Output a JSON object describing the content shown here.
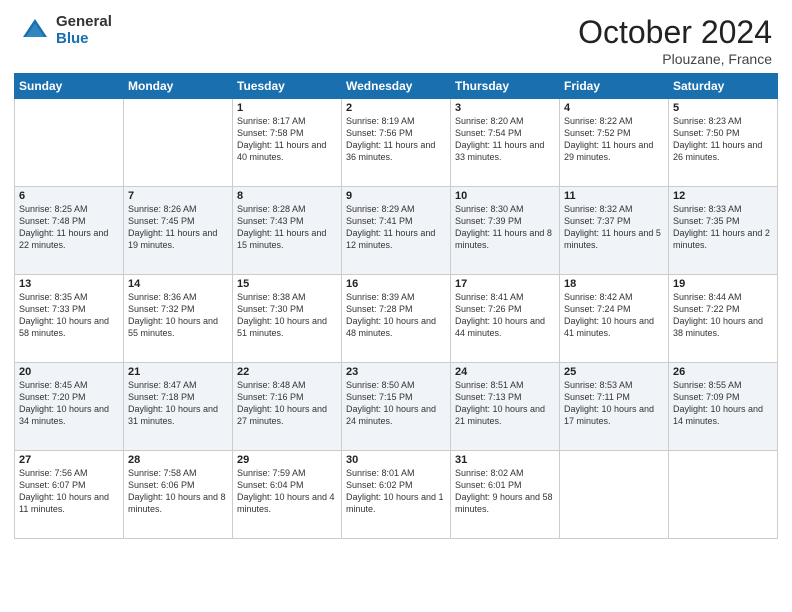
{
  "header": {
    "logo_general": "General",
    "logo_blue": "Blue",
    "month_title": "October 2024",
    "location": "Plouzane, France"
  },
  "days_of_week": [
    "Sunday",
    "Monday",
    "Tuesday",
    "Wednesday",
    "Thursday",
    "Friday",
    "Saturday"
  ],
  "weeks": [
    [
      {
        "day": "",
        "info": ""
      },
      {
        "day": "",
        "info": ""
      },
      {
        "day": "1",
        "info": "Sunrise: 8:17 AM\nSunset: 7:58 PM\nDaylight: 11 hours and 40 minutes."
      },
      {
        "day": "2",
        "info": "Sunrise: 8:19 AM\nSunset: 7:56 PM\nDaylight: 11 hours and 36 minutes."
      },
      {
        "day": "3",
        "info": "Sunrise: 8:20 AM\nSunset: 7:54 PM\nDaylight: 11 hours and 33 minutes."
      },
      {
        "day": "4",
        "info": "Sunrise: 8:22 AM\nSunset: 7:52 PM\nDaylight: 11 hours and 29 minutes."
      },
      {
        "day": "5",
        "info": "Sunrise: 8:23 AM\nSunset: 7:50 PM\nDaylight: 11 hours and 26 minutes."
      }
    ],
    [
      {
        "day": "6",
        "info": "Sunrise: 8:25 AM\nSunset: 7:48 PM\nDaylight: 11 hours and 22 minutes."
      },
      {
        "day": "7",
        "info": "Sunrise: 8:26 AM\nSunset: 7:45 PM\nDaylight: 11 hours and 19 minutes."
      },
      {
        "day": "8",
        "info": "Sunrise: 8:28 AM\nSunset: 7:43 PM\nDaylight: 11 hours and 15 minutes."
      },
      {
        "day": "9",
        "info": "Sunrise: 8:29 AM\nSunset: 7:41 PM\nDaylight: 11 hours and 12 minutes."
      },
      {
        "day": "10",
        "info": "Sunrise: 8:30 AM\nSunset: 7:39 PM\nDaylight: 11 hours and 8 minutes."
      },
      {
        "day": "11",
        "info": "Sunrise: 8:32 AM\nSunset: 7:37 PM\nDaylight: 11 hours and 5 minutes."
      },
      {
        "day": "12",
        "info": "Sunrise: 8:33 AM\nSunset: 7:35 PM\nDaylight: 11 hours and 2 minutes."
      }
    ],
    [
      {
        "day": "13",
        "info": "Sunrise: 8:35 AM\nSunset: 7:33 PM\nDaylight: 10 hours and 58 minutes."
      },
      {
        "day": "14",
        "info": "Sunrise: 8:36 AM\nSunset: 7:32 PM\nDaylight: 10 hours and 55 minutes."
      },
      {
        "day": "15",
        "info": "Sunrise: 8:38 AM\nSunset: 7:30 PM\nDaylight: 10 hours and 51 minutes."
      },
      {
        "day": "16",
        "info": "Sunrise: 8:39 AM\nSunset: 7:28 PM\nDaylight: 10 hours and 48 minutes."
      },
      {
        "day": "17",
        "info": "Sunrise: 8:41 AM\nSunset: 7:26 PM\nDaylight: 10 hours and 44 minutes."
      },
      {
        "day": "18",
        "info": "Sunrise: 8:42 AM\nSunset: 7:24 PM\nDaylight: 10 hours and 41 minutes."
      },
      {
        "day": "19",
        "info": "Sunrise: 8:44 AM\nSunset: 7:22 PM\nDaylight: 10 hours and 38 minutes."
      }
    ],
    [
      {
        "day": "20",
        "info": "Sunrise: 8:45 AM\nSunset: 7:20 PM\nDaylight: 10 hours and 34 minutes."
      },
      {
        "day": "21",
        "info": "Sunrise: 8:47 AM\nSunset: 7:18 PM\nDaylight: 10 hours and 31 minutes."
      },
      {
        "day": "22",
        "info": "Sunrise: 8:48 AM\nSunset: 7:16 PM\nDaylight: 10 hours and 27 minutes."
      },
      {
        "day": "23",
        "info": "Sunrise: 8:50 AM\nSunset: 7:15 PM\nDaylight: 10 hours and 24 minutes."
      },
      {
        "day": "24",
        "info": "Sunrise: 8:51 AM\nSunset: 7:13 PM\nDaylight: 10 hours and 21 minutes."
      },
      {
        "day": "25",
        "info": "Sunrise: 8:53 AM\nSunset: 7:11 PM\nDaylight: 10 hours and 17 minutes."
      },
      {
        "day": "26",
        "info": "Sunrise: 8:55 AM\nSunset: 7:09 PM\nDaylight: 10 hours and 14 minutes."
      }
    ],
    [
      {
        "day": "27",
        "info": "Sunrise: 7:56 AM\nSunset: 6:07 PM\nDaylight: 10 hours and 11 minutes."
      },
      {
        "day": "28",
        "info": "Sunrise: 7:58 AM\nSunset: 6:06 PM\nDaylight: 10 hours and 8 minutes."
      },
      {
        "day": "29",
        "info": "Sunrise: 7:59 AM\nSunset: 6:04 PM\nDaylight: 10 hours and 4 minutes."
      },
      {
        "day": "30",
        "info": "Sunrise: 8:01 AM\nSunset: 6:02 PM\nDaylight: 10 hours and 1 minute."
      },
      {
        "day": "31",
        "info": "Sunrise: 8:02 AM\nSunset: 6:01 PM\nDaylight: 9 hours and 58 minutes."
      },
      {
        "day": "",
        "info": ""
      },
      {
        "day": "",
        "info": ""
      }
    ]
  ]
}
